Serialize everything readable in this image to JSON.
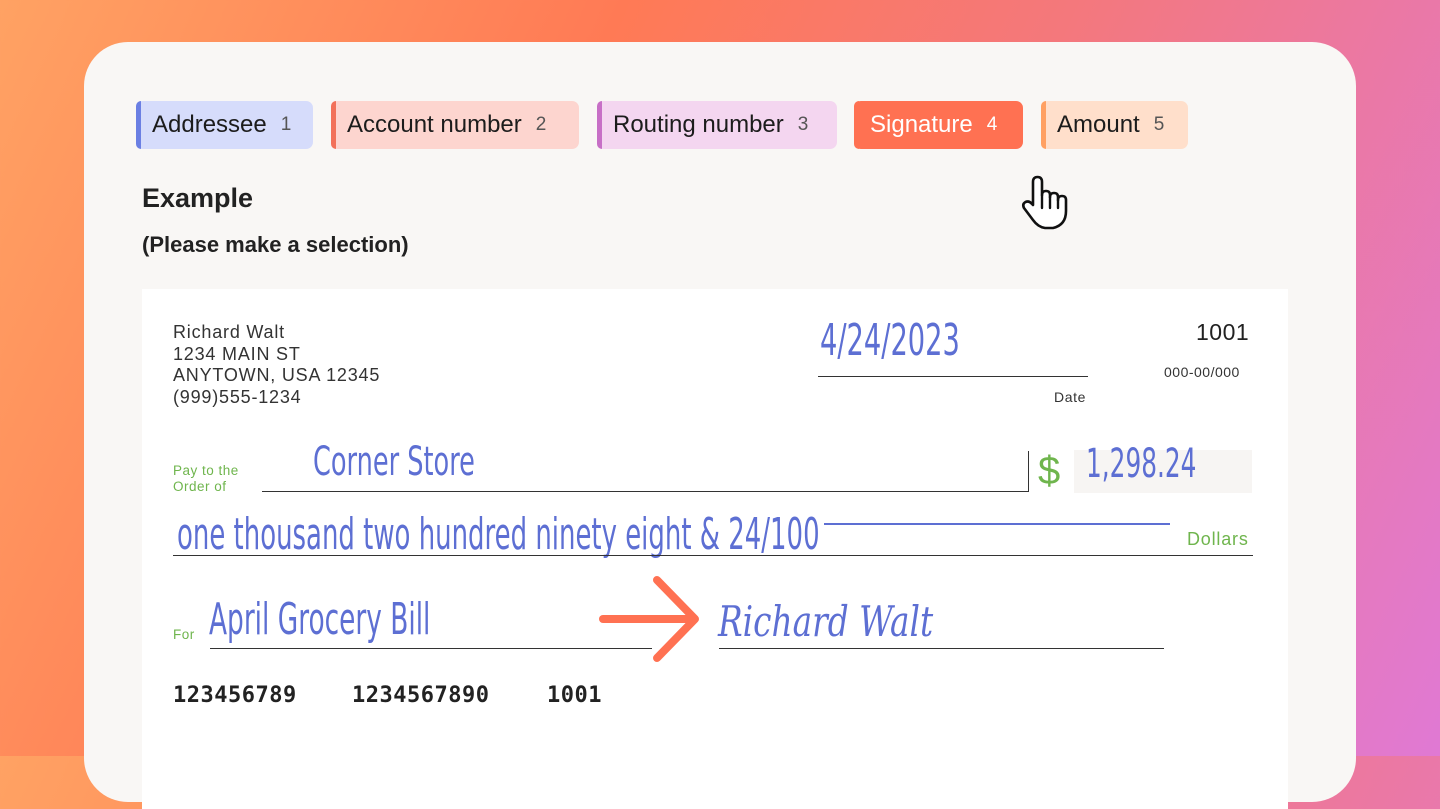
{
  "tabs": [
    {
      "label": "Addressee",
      "num": "1",
      "bg": "#d6dcfb",
      "bar": "#6b7fe3",
      "active": false
    },
    {
      "label": "Account number",
      "num": "2",
      "bg": "#fdd5cf",
      "bar": "#f2715a",
      "active": false
    },
    {
      "label": "Routing number",
      "num": "3",
      "bg": "#f4d6f0",
      "bar": "#c76fc6",
      "active": false
    },
    {
      "label": "Signature",
      "num": "4",
      "bg": "#ff7152",
      "bar": "#ff7152",
      "active": true
    },
    {
      "label": "Amount",
      "num": "5",
      "bg": "#ffdfcb",
      "bar": "#ffa062",
      "active": false
    }
  ],
  "example": {
    "title": "Example",
    "subtitle": "(Please make a selection)"
  },
  "check": {
    "address": [
      "Richard Walt",
      "1234 MAIN ST",
      "ANYTOWN, USA 12345",
      "(999)555-1234"
    ],
    "date": "4/24/2023",
    "date_label": "Date",
    "check_number": "1001",
    "routing_fraction": "000-00/000",
    "pay_label": [
      "Pay to the",
      "Order of"
    ],
    "payee": "Corner Store",
    "dollar_sign": "$",
    "amount": "1,298.24",
    "amount_words": "one thousand two hundred ninety eight & 24/100",
    "dollars_label": "Dollars",
    "for_label": "For",
    "memo": "April Grocery Bill",
    "signature": "Richard Walt",
    "micr": {
      "routing": "123456789",
      "account": "1234567890",
      "check": "1001"
    }
  },
  "colors": {
    "handwriting": "#5d6fd3",
    "label_green": "#6fb54d",
    "accent": "#ff7152"
  },
  "icons": {
    "cursor": "hand-pointer-icon",
    "arrow": "arrow-right-icon"
  }
}
